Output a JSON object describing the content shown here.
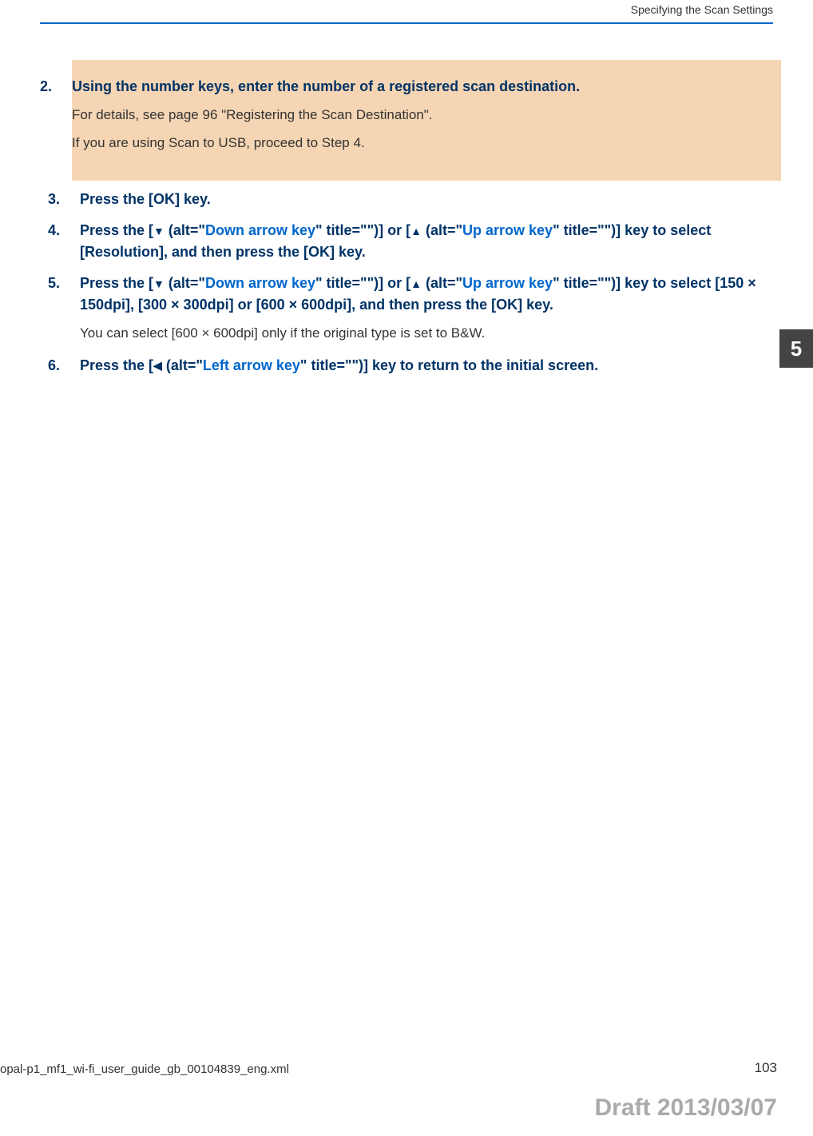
{
  "header": {
    "section_title": "Specifying the Scan Settings"
  },
  "steps": [
    {
      "number": "2.",
      "title": "Using the number keys, enter the number of a registered scan destination.",
      "body_lines": [
        "For details, see page 96 \"Registering the Scan Destination\".",
        "If you are using Scan to USB, proceed to Step 4."
      ],
      "highlighted": true
    },
    {
      "number": "3.",
      "title": "Press the [OK] key.",
      "body_lines": [],
      "highlighted": false
    },
    {
      "number": "4.",
      "title_parts": {
        "p1": "Press the [",
        "arrow1": "▼",
        "p2": " (alt=\"",
        "link1": "Down arrow key",
        "p3": "\" title=\"\")] or [",
        "arrow2": "▲",
        "p4": " (alt=\"",
        "link2": "Up arrow key",
        "p5": "\" title=\"\")] key to select [Resolution], and then press the [OK] key."
      },
      "body_lines": [],
      "highlighted": false
    },
    {
      "number": "5.",
      "title_parts": {
        "p1": "Press the [",
        "arrow1": "▼",
        "p2": " (alt=\"",
        "link1": "Down arrow key",
        "p3": "\" title=\"\")] or [",
        "arrow2": "▲",
        "p4": " (alt=\"",
        "link2": "Up arrow key",
        "p5": "\" title=\"\")] key to select [150 × 150dpi], [300 × 300dpi] or [600 × 600dpi], and then press the [OK] key."
      },
      "body_lines": [
        "You can select [600 × 600dpi] only if the original type is set to B&W."
      ],
      "highlighted": false
    },
    {
      "number": "6.",
      "title_parts": {
        "p1": "Press the [",
        "arrow1": "◀",
        "p2": " (alt=\"",
        "link1": "Left arrow key",
        "p3": "\" title=\"\")] key to return to the initial screen."
      },
      "body_lines": [],
      "highlighted": false
    }
  ],
  "chapter_tab": "5",
  "footer": {
    "filename": "opal-p1_mf1_wi-fi_user_guide_gb_00104839_eng.xml",
    "page_number": "103"
  },
  "draft_stamp": "Draft 2013/03/07"
}
